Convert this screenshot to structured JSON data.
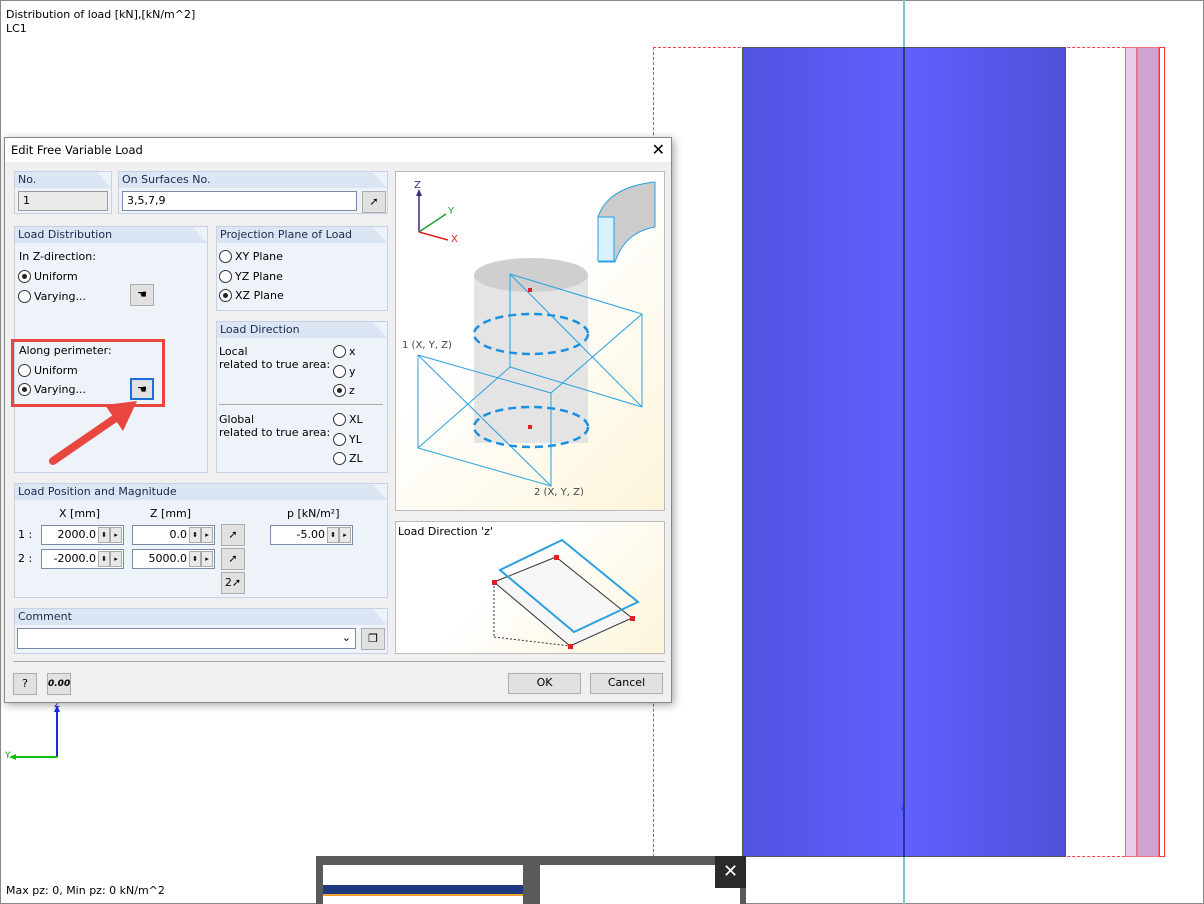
{
  "canvas": {
    "info_line1": "Distribution of load [kN],[kN/m^2]",
    "info_line2": "LC1",
    "status": "Max pz: 0, Min pz: 0 kN/m^2",
    "axis_z": "Z",
    "axis_y": "Y",
    "colors": {
      "surface": "#5a5cf5",
      "boundary": "#ff3030",
      "axis_line": "#7fc7c7",
      "strip": "#d9a6d6"
    }
  },
  "dialog": {
    "title": "Edit Free Variable Load",
    "no": {
      "label": "No.",
      "value": "1"
    },
    "surfaces": {
      "label": "On Surfaces No.",
      "value": "3,5,7,9"
    },
    "load_distribution": {
      "label": "Load Distribution",
      "z_direction": "In Z-direction:",
      "z_options": [
        "Uniform",
        "Varying..."
      ],
      "z_selected": "Uniform",
      "perimeter": "Along perimeter:",
      "perimeter_options": [
        "Uniform",
        "Varying..."
      ],
      "perimeter_selected": "Varying..."
    },
    "projection": {
      "label": "Projection Plane of Load",
      "options": [
        "XY Plane",
        "YZ Plane",
        "XZ Plane"
      ],
      "selected": "XZ Plane"
    },
    "direction": {
      "label": "Load Direction",
      "local_label1": "Local",
      "local_label2": "related to true area:",
      "local_options": [
        "x",
        "y",
        "z"
      ],
      "global_label1": "Global",
      "global_label2": "related to true area:",
      "global_options": [
        "XL",
        "YL",
        "ZL"
      ],
      "selected": "z"
    },
    "position": {
      "label": "Load Position and Magnitude",
      "col_x": "X  [mm]",
      "col_z": "Z  [mm]",
      "col_p": "p  [kN/m²]",
      "rows": [
        {
          "label": "1 :",
          "x": "2000.0",
          "z": "0.0"
        },
        {
          "label": "2 :",
          "x": "-2000.0",
          "z": "5000.0"
        }
      ],
      "p": "-5.00"
    },
    "comment": {
      "label": "Comment",
      "value": ""
    },
    "figure": {
      "label_1": "1 (X, Y, Z)",
      "label_2": "2 (X, Y, Z)",
      "ax_x": "X",
      "ax_y": "Y",
      "ax_z": "Z"
    },
    "direction_figure": {
      "title": "Load Direction 'z'"
    },
    "ok": "OK",
    "cancel": "Cancel",
    "units_icon_text": "0.00"
  },
  "highlight_color": "#e8463f"
}
